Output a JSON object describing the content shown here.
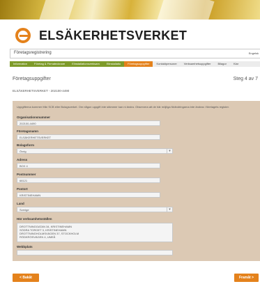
{
  "brand": {
    "name": "ELSÄKERHETSVERKET",
    "accent": "#e4821c",
    "step_green": "#7e9b2a"
  },
  "appbar": {
    "title": "Företagsregistrering",
    "right_text": "Engelsk"
  },
  "steps": [
    {
      "label": "Information",
      "state": "done"
    },
    {
      "label": "Företag & Firmatecknare",
      "state": "done"
    },
    {
      "label": "Elinstallationsverksam",
      "state": "done"
    },
    {
      "label": "Elinstallatio",
      "state": "done"
    },
    {
      "label": "Företagsuppgifter",
      "state": "active"
    },
    {
      "label": "Kontaktpersoner",
      "state": "future"
    },
    {
      "label": "Verksamhetsuppgifter",
      "state": "future"
    },
    {
      "label": "Bilagor",
      "state": "future"
    },
    {
      "label": "Klar",
      "state": "future"
    }
  ],
  "page": {
    "title": "Företagsuppgifter",
    "step": "Steg 4 av 7",
    "company": "ELSÄKERHETSVERKET - 202100-4490"
  },
  "intro": "Uppgifterna kommer från SCB eller Bolagsverket. Om någon uppgift inte stämmer kan ni ändra. Observera att de här möjliga förändringarna inte ändras i företagets register.",
  "form": {
    "orgnr_label": "Organisationsnummer",
    "orgnr_value": "202100-4490",
    "name_label": "Företagsnamn",
    "name_value": "ELSÄKERHETSVERKET",
    "bolagsform_label": "Bolagsform",
    "bolagsform_value": "Övrig",
    "adress_label": "Adress",
    "adress_value": "BOX 4",
    "postnr_label": "Postnummer",
    "postnr_value": "68121",
    "postort_label": "Postort",
    "postort_value": "KRISTINEHAMN",
    "land_label": "Land",
    "land_value": "Sverige",
    "verksamhet_label": "Här verksamhetsställen",
    "verksamhet_lines": [
      "DROTTNINGGATAN 34, KRISTINEHAMN",
      "SÖDRA TORGET 3, KRISTINEHAMN",
      "DROTTNINGHOLMSVÄGEN 37, STOCKHOLM",
      "RÖDKRÖSVÄGEN 4, UMEÅ"
    ],
    "webb_label": "Webbplats",
    "webb_value": ""
  },
  "nav": {
    "back": "< Bakåt",
    "next": "Framåt >"
  },
  "icons": {
    "select_arrow": "chevron-down-icon"
  }
}
